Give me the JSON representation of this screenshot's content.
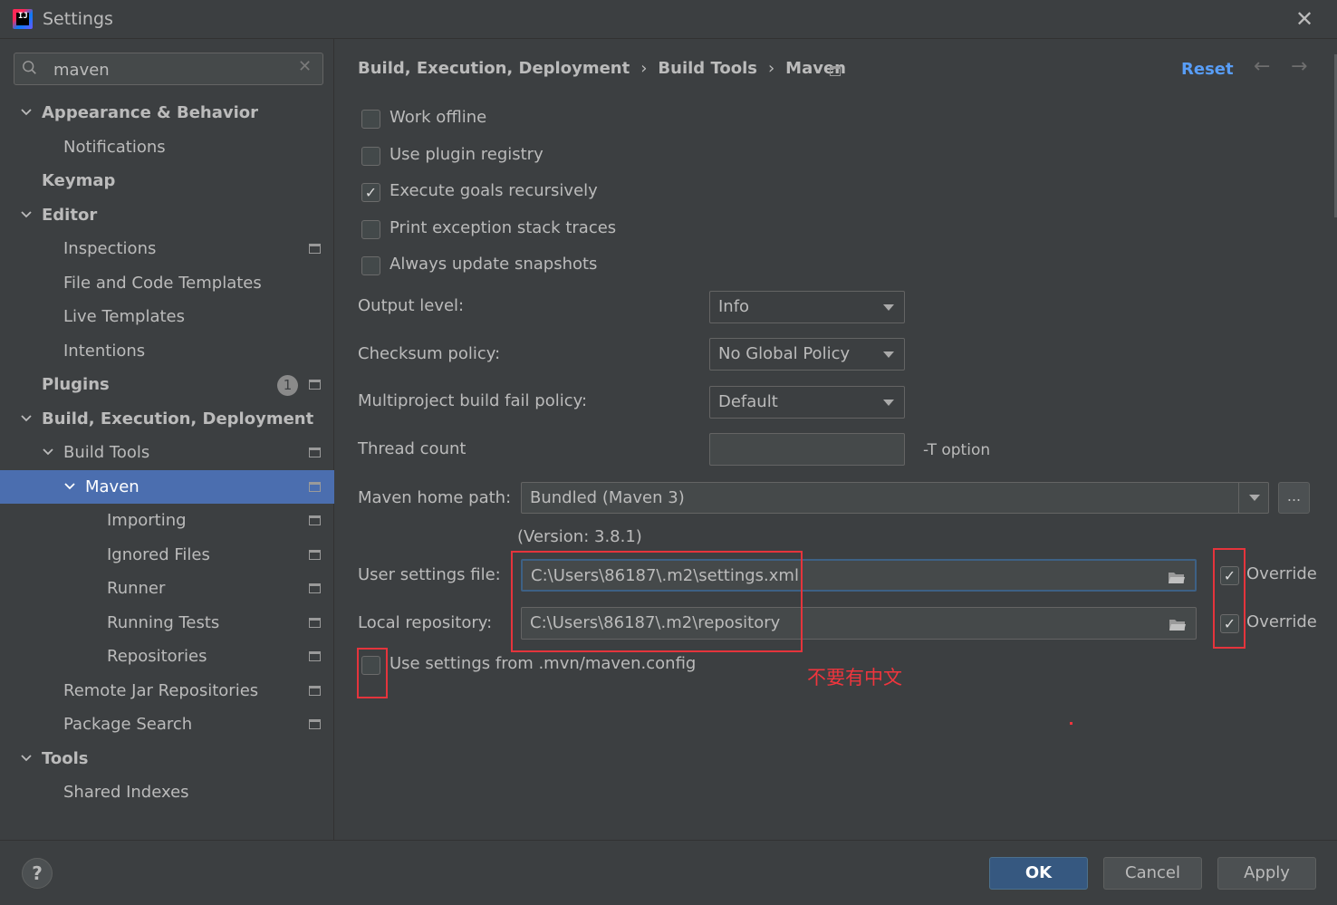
{
  "window": {
    "title": "Settings",
    "close_glyph": "✕",
    "icon_letters": "IJ"
  },
  "search": {
    "value": "maven",
    "clear_glyph": "✕"
  },
  "sidebar": {
    "items": [
      {
        "label": "Appearance & Behavior",
        "chevron": "expanded",
        "bold": true
      },
      {
        "label": "Notifications"
      },
      {
        "label": "Keymap",
        "bold": true
      },
      {
        "label": "Editor",
        "chevron": "expanded",
        "bold": true
      },
      {
        "label": "Inspections",
        "project_icon": true
      },
      {
        "label": "File and Code Templates"
      },
      {
        "label": "Live Templates"
      },
      {
        "label": "Intentions"
      },
      {
        "label": "Plugins",
        "bold": true,
        "badge": "1",
        "project_icon": true
      },
      {
        "label": "Build, Execution, Deployment",
        "chevron": "expanded",
        "bold": true
      },
      {
        "label": "Build Tools",
        "chevron": "expanded",
        "project_icon": true
      },
      {
        "label": "Maven",
        "chevron": "expanded",
        "project_icon": true,
        "selected": true
      },
      {
        "label": "Importing",
        "project_icon": true
      },
      {
        "label": "Ignored Files",
        "project_icon": true
      },
      {
        "label": "Runner",
        "project_icon": true
      },
      {
        "label": "Running Tests",
        "project_icon": true
      },
      {
        "label": "Repositories",
        "project_icon": true
      },
      {
        "label": "Remote Jar Repositories",
        "project_icon": true
      },
      {
        "label": "Package Search",
        "project_icon": true
      },
      {
        "label": "Tools",
        "chevron": "expanded",
        "bold": true
      },
      {
        "label": "Shared Indexes"
      }
    ]
  },
  "breadcrumb": {
    "items": [
      "Build, Execution, Deployment",
      "Build Tools",
      "Maven"
    ],
    "separator": "›",
    "reset_label": "Reset",
    "back_glyph": "←",
    "forward_glyph": "→"
  },
  "options": {
    "work_offline": {
      "label": "Work offline",
      "checked": false
    },
    "use_plugin_registry": {
      "label": "Use plugin registry",
      "checked": false
    },
    "execute_goals_recursively": {
      "label": "Execute goals recursively",
      "checked": true
    },
    "print_exception_stack_traces": {
      "label": "Print exception stack traces",
      "checked": false
    },
    "always_update_snapshots": {
      "label": "Always update snapshots",
      "checked": false
    }
  },
  "form": {
    "output_level": {
      "label": "Output level:",
      "value": "Info"
    },
    "checksum_policy": {
      "label": "Checksum policy:",
      "value": "No Global Policy"
    },
    "multiproject_fail_policy": {
      "label": "Multiproject build fail policy:",
      "value": "Default"
    },
    "thread_count": {
      "label": "Thread count",
      "value": "",
      "hint": "-T option"
    },
    "maven_home": {
      "label": "Maven home path:",
      "value": "Bundled (Maven 3)",
      "browse_label": "...",
      "version": "(Version: 3.8.1)"
    },
    "user_settings": {
      "label": "User settings file:",
      "value": "C:\\Users\\86187\\.m2\\settings.xml",
      "override_label": "Override",
      "override_checked": true
    },
    "local_repository": {
      "label": "Local repository:",
      "value": "C:\\Users\\86187\\.m2\\repository",
      "override_label": "Override",
      "override_checked": true
    },
    "use_mvn_config": {
      "label": "Use settings from .mvn/maven.config",
      "checked": false
    }
  },
  "annotation": {
    "text": "不要有中文",
    "color": "#f0353d"
  },
  "footer": {
    "help_label": "?",
    "ok_label": "OK",
    "cancel_label": "Cancel",
    "apply_label": "Apply"
  },
  "colors": {
    "background": "#3c3f41",
    "selection": "#4b6eaf",
    "link": "#589df6",
    "primary_button": "#365880",
    "annotation_red": "#e5343c"
  },
  "icons": {
    "check": "✓"
  }
}
